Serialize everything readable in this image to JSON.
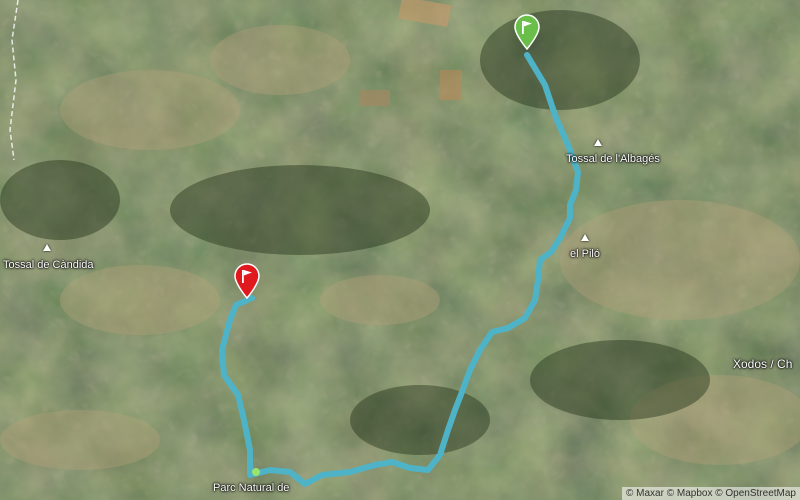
{
  "map": {
    "labels": {
      "tossal_albages": "Tossal de l'Albagés",
      "el_pilo": "el Piló",
      "tossal_candida": "Tossal de Càndida",
      "xodos": "Xodos / Ch",
      "parc_natural": "Parc Natural de"
    },
    "route_color": "#4fb3c8",
    "start_marker_color": "#6abf4b",
    "end_marker_color": "#e0191f",
    "start_icon": "flag-icon",
    "end_icon": "flag-icon"
  },
  "attribution": {
    "maxar": "© Maxar",
    "mapbox": "© Mapbox",
    "osm": "© OpenStreetMap"
  }
}
